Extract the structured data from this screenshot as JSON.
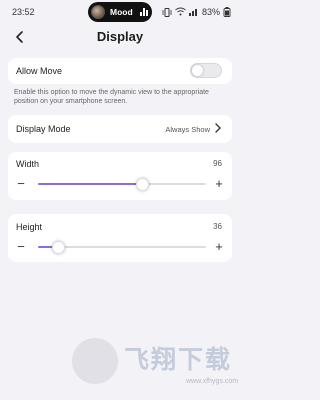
{
  "status_bar": {
    "time": "23:52",
    "island_label": "Mood",
    "battery": "83%"
  },
  "header": {
    "title": "Display"
  },
  "allow_move": {
    "label": "Allow Move",
    "enabled": false,
    "description": "Enable this option to move the dynamic view to the appropriate position on your smartphone screen."
  },
  "display_mode": {
    "label": "Display Mode",
    "value": "Always Show"
  },
  "width": {
    "label": "Width",
    "value": "96",
    "level": 0.62
  },
  "height": {
    "label": "Height",
    "value": "36",
    "level": 0.12
  },
  "watermark": {
    "text": "飞翔下载",
    "url": "www.xfhygs.com"
  },
  "colors": {
    "accent": "#8a6de0",
    "background": "#f3f2f7"
  }
}
